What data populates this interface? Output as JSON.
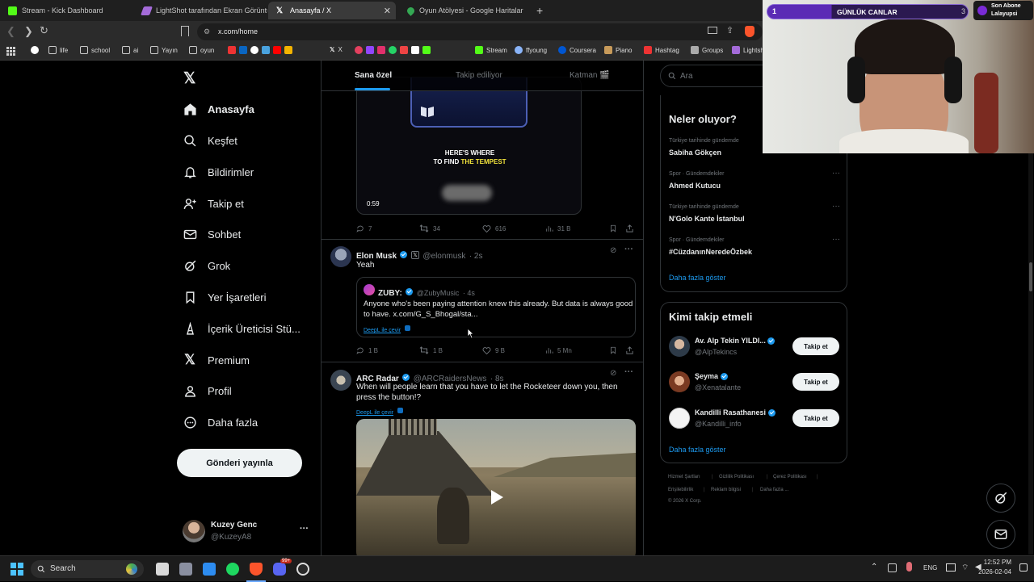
{
  "browser": {
    "tabs": [
      {
        "label": "Stream - Kick Dashboard",
        "color": "#53fc18"
      },
      {
        "label": "LightShot tarafından Ekran Görüntüs",
        "color": "#a46bd9"
      },
      {
        "label": "Anasayfa / X",
        "color": "#ffffff",
        "active": true
      },
      {
        "label": "Oyun Atölyesi - Google Haritalar",
        "color": "#34a853"
      }
    ],
    "url": "x.com/home",
    "bookmarks": [
      "life",
      "school",
      "ai",
      "Yayın",
      "oyun",
      "X",
      "Stream",
      "ffyoung",
      "Coursera",
      "Piano",
      "Hashtag",
      "Groups",
      "Lightsh"
    ]
  },
  "x": {
    "nav": [
      {
        "label": "Anasayfa",
        "icon": "home-icon",
        "active": true
      },
      {
        "label": "Keşfet",
        "icon": "search-icon"
      },
      {
        "label": "Bildirimler",
        "icon": "bell-icon"
      },
      {
        "label": "Takip et",
        "icon": "follow-icon"
      },
      {
        "label": "Sohbet",
        "icon": "mail-icon"
      },
      {
        "label": "Grok",
        "icon": "grok-icon"
      },
      {
        "label": "Yer İşaretleri",
        "icon": "bookmark-icon"
      },
      {
        "label": "İçerik Üreticisi Stü...",
        "icon": "creator-studio-icon"
      },
      {
        "label": "Premium",
        "icon": "x-logo-icon"
      },
      {
        "label": "Profil",
        "icon": "person-icon"
      },
      {
        "label": "Daha fazla",
        "icon": "more-circle-icon"
      }
    ],
    "post_button": "Gönderi yayınla",
    "account": {
      "name": "Kuzey Genc",
      "handle": "@KuzeyA8"
    },
    "feed_tabs": [
      "Sana özel",
      "Takip ediliyor",
      "Katman 🎬"
    ],
    "video_card": {
      "caption_line1": "HERE'S WHERE",
      "caption_line2a": "TO FIND ",
      "caption_line2b": "THE TEMPEST",
      "duration": "0:59",
      "replies": "7",
      "reposts": "34",
      "likes": "616",
      "views": "31 B"
    },
    "tweets": [
      {
        "name": "Elon Musk",
        "handle": "@elonmusk",
        "time": "· 2s",
        "text": "Yeah",
        "quote": {
          "name": "ZUBY:",
          "handle": "@ZubyMusic",
          "time": "· 4s",
          "text": "Anyone who's been paying attention knew this already. But data is always good to have. x.com/G_S_Bhogal/sta...",
          "translate": "DeepL ile çevir"
        },
        "replies": "1 B",
        "reposts": "1 B",
        "likes": "9 B",
        "views": "5 Mn"
      },
      {
        "name": "ARC Radar",
        "handle": "@ARCRaidersNews",
        "time": "· 8s",
        "text": "When will people learn that you have to let the Rocketeer down you, then press the button!?",
        "translate": "DeepL ile çevir"
      }
    ],
    "search_placeholder": "Ara",
    "trends_title": "Neler oluyor?",
    "trends": [
      {
        "meta": "Türkiye tarihinde gündemde",
        "title": "Sabiha Gökçen"
      },
      {
        "meta": "Spor · Gündemdekiler",
        "title": "Ahmed Kutucu"
      },
      {
        "meta": "Türkiye tarihinde gündemde",
        "title": "N'Golo Kante İstanbul"
      },
      {
        "meta": "Spor · Gündemdekiler",
        "title": "#CüzdanınNeredeÖzbek"
      }
    ],
    "show_more": "Daha fazla göster",
    "who_to_follow_title": "Kimi takip etmeli",
    "who_to_follow": [
      {
        "name": "Av. Alp Tekin YILDI...",
        "handle": "@AlpTekincs"
      },
      {
        "name": "Şeyma",
        "handle": "@Xenatalante"
      },
      {
        "name": "Kandilli Rasathanesi",
        "handle": "@Kandilli_info"
      }
    ],
    "follow_label": "Takip et",
    "footer": [
      "Hizmet Şartları",
      "Gizlilik Politikası",
      "Çerez Politikası",
      "Erişilebilirlik",
      "Reklam bilgisi",
      "Daha fazla ...",
      "© 2026 X Corp."
    ]
  },
  "overlay": {
    "rank": "1",
    "label": "GÜNLÜK CANLAR",
    "count": "3",
    "sub_line1": "Son Abone",
    "sub_line2": "Lalayupsi"
  },
  "taskbar": {
    "search": "Search",
    "lang": "ENG",
    "time": "12:52 PM",
    "date": "2026-02-04",
    "notification_badge": "99+"
  }
}
